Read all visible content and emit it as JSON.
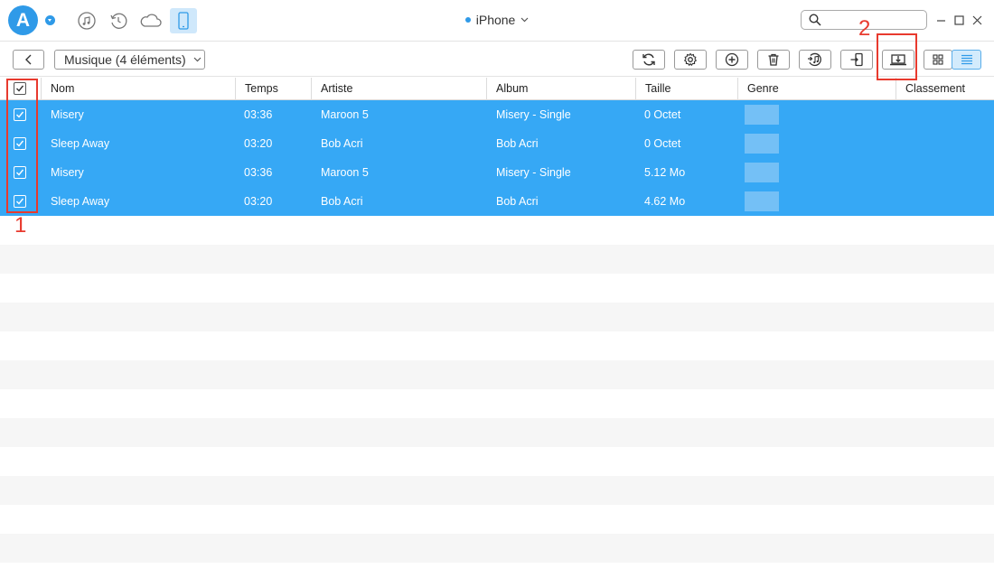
{
  "app": {
    "logo_letter": "A"
  },
  "device": {
    "name": "iPhone"
  },
  "toolbar": {
    "category": "Musique (4 éléments)"
  },
  "annotations": {
    "one": "1",
    "two": "2",
    "color": "#e83a2e"
  },
  "colors": {
    "accent": "#2f9ae8",
    "selected_row": "#36a8f5",
    "stripe": "#f6f6f6"
  },
  "columns": [
    "Nom",
    "Temps",
    "Artiste",
    "Album",
    "Taille",
    "Genre",
    "Classement"
  ],
  "rows": [
    {
      "name": "Misery",
      "time": "03:36",
      "artist": "Maroon 5",
      "album": "Misery - Single",
      "size": "0 Octet",
      "checked": true
    },
    {
      "name": "Sleep Away",
      "time": "03:20",
      "artist": "Bob Acri",
      "album": "Bob Acri",
      "size": "0 Octet",
      "checked": true
    },
    {
      "name": "Misery",
      "time": "03:36",
      "artist": "Maroon 5",
      "album": "Misery - Single",
      "size": "5.12 Mo",
      "checked": true
    },
    {
      "name": "Sleep Away",
      "time": "03:20",
      "artist": "Bob Acri",
      "album": "Bob Acri",
      "size": "4.62 Mo",
      "checked": true
    }
  ],
  "icons": {
    "nav": [
      "itunes-icon",
      "history-icon",
      "icloud-icon",
      "device-icon"
    ],
    "toolbar": [
      "refresh-icon",
      "settings-icon",
      "add-icon",
      "delete-icon",
      "to-itunes-icon",
      "to-device-icon",
      "export-to-pc-icon",
      "grid-view-icon",
      "list-view-icon"
    ]
  }
}
